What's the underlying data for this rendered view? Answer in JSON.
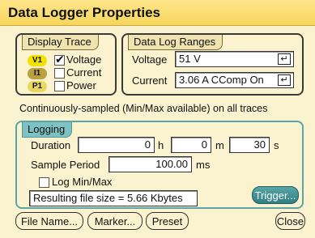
{
  "window": {
    "title": "Data Logger Properties"
  },
  "display_trace": {
    "label": "Display Trace",
    "items": [
      {
        "badge": "V1",
        "label": "Voltage",
        "checked": true
      },
      {
        "badge": "I1",
        "label": "Current",
        "checked": false
      },
      {
        "badge": "P1",
        "label": "Power",
        "checked": false
      }
    ]
  },
  "data_log_ranges": {
    "label": "Data Log Ranges",
    "voltage_label": "Voltage",
    "voltage_value": "51 V",
    "current_label": "Current",
    "current_value": "3.06 A CComp On",
    "enter_glyph": "↵"
  },
  "status_text": "Continuously-sampled (Min/Max available)  on all traces",
  "logging": {
    "label": "Logging",
    "duration_label": "Duration",
    "hours": "0",
    "hours_unit": "h",
    "minutes": "0",
    "minutes_unit": "m",
    "seconds": "30",
    "seconds_unit": "s",
    "sample_period_label": "Sample Period",
    "sample_period": "100.00",
    "sample_period_unit": "ms",
    "log_minmax_label": "Log Min/Max",
    "log_minmax_checked": false,
    "file_size_text": "Resulting file size = 5.66 Kbytes",
    "trigger_label": "Trigger..."
  },
  "buttons": {
    "file_name": "File Name...",
    "marker": "Marker...",
    "preset": "Preset",
    "close": "Close"
  }
}
